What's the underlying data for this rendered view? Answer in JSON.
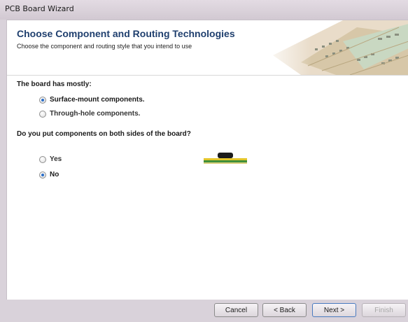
{
  "window": {
    "title": "PCB Board Wizard"
  },
  "header": {
    "title": "Choose Component and Routing Technologies",
    "subtitle": "Choose the component and routing style that you intend to use"
  },
  "question1": {
    "label": "The board has mostly:",
    "options": [
      {
        "label": "Surface-mount components.",
        "checked": true
      },
      {
        "label": "Through-hole components.",
        "checked": false
      }
    ]
  },
  "question2": {
    "label": "Do you put components on both sides of the board?",
    "options": [
      {
        "label": "Yes",
        "checked": false
      },
      {
        "label": "No",
        "checked": true
      }
    ]
  },
  "footer": {
    "cancel_label": "Cancel",
    "back_label": "< Back",
    "next_label": "Next >",
    "finish_label": "Finish"
  },
  "colors": {
    "header_title": "#1f3f6e",
    "radio_checked": "#2a6ec9",
    "board_yellow": "#e3c62a",
    "board_green": "#3f8f3a"
  }
}
